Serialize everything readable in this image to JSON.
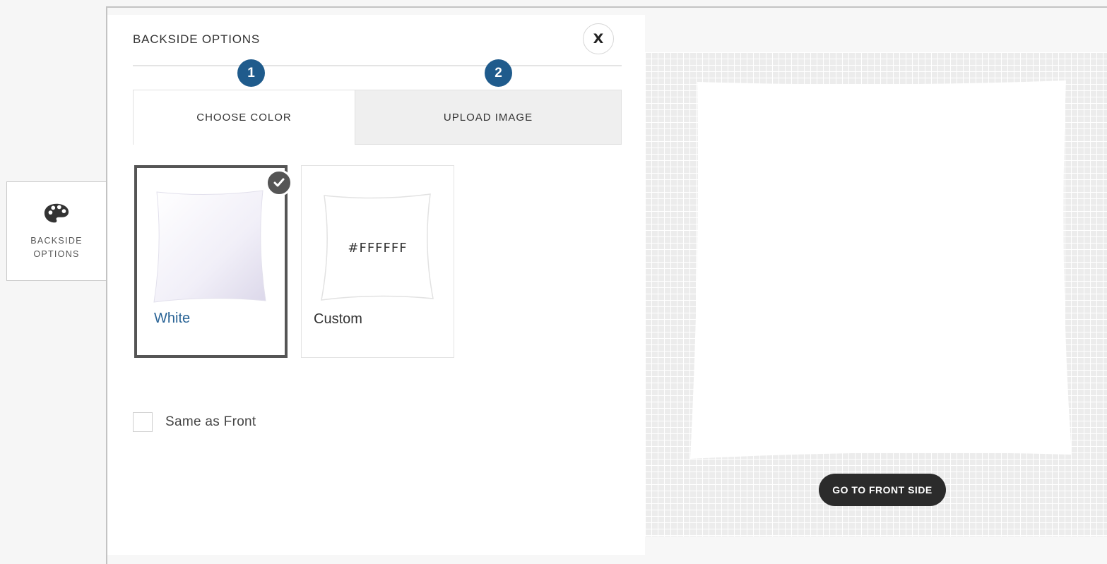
{
  "side_tab": {
    "label": "BACKSIDE OPTIONS",
    "icon": "palette-icon"
  },
  "panel": {
    "title": "BACKSIDE OPTIONS",
    "close_label": "X",
    "steps": [
      "1",
      "2"
    ],
    "tabs": [
      {
        "label": "CHOOSE COLOR",
        "active": true
      },
      {
        "label": "UPLOAD IMAGE",
        "active": false
      }
    ],
    "swatches": [
      {
        "name": "White",
        "selected": true
      },
      {
        "name": "Custom",
        "selected": false,
        "hex": "#FFFFFF"
      }
    ],
    "same_as_front_label": "Same as Front",
    "same_as_front_checked": false
  },
  "preview": {
    "button_label": "GO TO FRONT SIDE"
  },
  "colors": {
    "accent": "#1f5b8c",
    "selected_border": "#555555",
    "link": "#2a6496",
    "button_bg": "#2b2b2b"
  }
}
